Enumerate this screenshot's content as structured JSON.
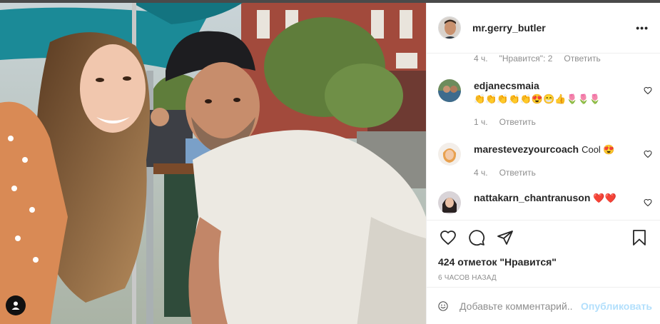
{
  "photo": {
    "alt_icon": "user-tag-icon"
  },
  "post": {
    "username": "mr.gerry_butler",
    "more_label": "•••"
  },
  "comments": [
    {
      "username": "",
      "text": "",
      "time": "4 ч.",
      "likes": "\"Нравится\": 2",
      "reply": "Ответить"
    },
    {
      "username": "edjanecsmaia",
      "text": "👏👏👏👏👏😍😁👍🌷🌷🌷",
      "time": "1 ч.",
      "likes": "",
      "reply": "Ответить"
    },
    {
      "username": "marestevezyourcoach",
      "text": "Cool 😍",
      "time": "4 ч.",
      "likes": "",
      "reply": "Ответить"
    },
    {
      "username": "nattakarn_chantranuson",
      "text": "❤️❤️",
      "time": "",
      "likes": "",
      "reply": ""
    }
  ],
  "actions": {
    "like_icon": "heart-icon",
    "comment_icon": "comment-icon",
    "share_icon": "share-icon",
    "save_icon": "bookmark-icon",
    "likes": "424 отметок \"Нравится\"",
    "time": "6 часов назад"
  },
  "add_comment": {
    "placeholder": "Добавьте комментарий...",
    "publish": "Опубликовать"
  },
  "colors": {
    "link": "#b2dffc",
    "muted": "#8e8e8e",
    "border": "#efefef"
  }
}
